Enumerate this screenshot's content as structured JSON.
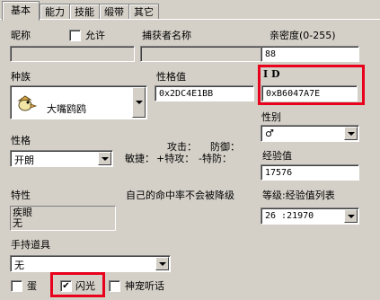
{
  "tabs": [
    "基本",
    "能力",
    "技能",
    "缎带",
    "其它"
  ],
  "nickname": {
    "label": "昵称",
    "allow_label": "允许",
    "value": ""
  },
  "catcher": {
    "label": "捕获者名称",
    "value": ""
  },
  "intimacy": {
    "label": "亲密度(0-255)",
    "value": "88"
  },
  "species": {
    "label": "种族",
    "value": "大嘴鸥鸥"
  },
  "personality_value": {
    "label": "性格值",
    "value": "0x2DC4E1BB"
  },
  "id": {
    "label": "I D",
    "value": "0xB6047A7E"
  },
  "gender": {
    "label": "性别",
    "value": "♂"
  },
  "nature": {
    "label": "性格",
    "value": "开朗",
    "attack_label": "攻击：",
    "defense_label": "防御：",
    "agility_label": "敏捷：",
    "special_attack_label": "+特攻：",
    "special_defense_label": "-特防："
  },
  "exp": {
    "label": "经验值",
    "value": "17576"
  },
  "trait": {
    "label": "特性",
    "options": [
      "疾眼",
      "无"
    ],
    "description": "自己的命中率不会被降级"
  },
  "level": {
    "label": "等级:经验值列表",
    "value": "26 :21970"
  },
  "held_item": {
    "label": "手持道具",
    "value": "无"
  },
  "flags": {
    "egg_label": "蛋",
    "shiny_label": "闪光",
    "shiny_checked": "✔",
    "pokedex_label": "神宠听话"
  },
  "colors": {
    "highlight": "#e8001c",
    "face": "#d4d0c8"
  }
}
